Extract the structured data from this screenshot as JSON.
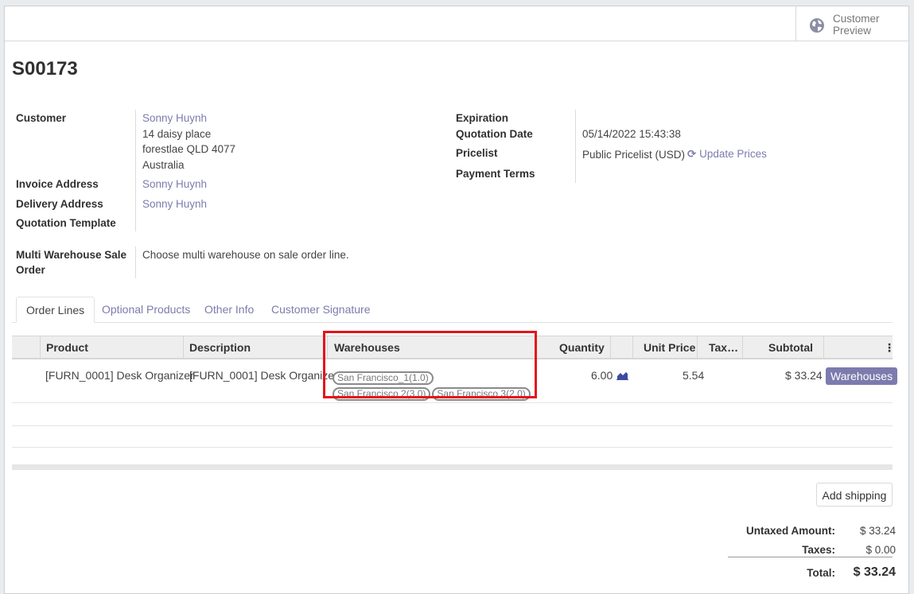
{
  "header": {
    "preview_label": "Customer\nPreview",
    "icon": "globe-icon"
  },
  "order": {
    "name": "S00173"
  },
  "left_fields": {
    "customer_label": "Customer",
    "customer_name": "Sonny Huynh",
    "address_line1": "14 daisy place",
    "address_line2": "forestlae QLD 4077",
    "address_line3": "Australia",
    "invoice_label": "Invoice Address",
    "invoice_value": "Sonny Huynh",
    "delivery_label": "Delivery Address",
    "delivery_value": "Sonny Huynh",
    "template_label": "Quotation Template",
    "multi_label_1": "Multi Warehouse Sale",
    "multi_label_2": "Order",
    "multi_value": "Choose multi warehouse on sale order line."
  },
  "right_fields": {
    "expiration_label": "Expiration",
    "quotation_date_label": "Quotation Date",
    "quotation_date_value": "05/14/2022 15:43:38",
    "pricelist_label": "Pricelist",
    "pricelist_value": "Public Pricelist (USD)",
    "update_prices": "Update Prices",
    "payment_terms_label": "Payment Terms"
  },
  "tabs": [
    "Order Lines",
    "Optional Products",
    "Other Info",
    "Customer Signature"
  ],
  "columns": {
    "product": "Product",
    "description": "Description",
    "warehouses": "Warehouses",
    "quantity": "Quantity",
    "unit_price": "Unit Price",
    "taxes": "Tax…",
    "subtotal": "Subtotal",
    "options": "⋮"
  },
  "line": {
    "product": "[FURN_0001] Desk Organizer",
    "description": "[FURN_0001] Desk Organizer",
    "warehouse_tags": [
      "San Francisco_1(1.0)",
      "San Francisco 2(3.0)",
      "San Francisco 3(2.0)"
    ],
    "quantity": "6.00",
    "unit_price": "5.54",
    "subtotal": "$ 33.24",
    "button": "Warehouses"
  },
  "totals": {
    "add_shipping": "Add shipping",
    "untaxed_label": "Untaxed Amount:",
    "untaxed_value": "$ 33.24",
    "taxes_label": "Taxes:",
    "taxes_value": "$ 0.00",
    "total_label": "Total:",
    "total_value": "$ 33.24"
  },
  "colors": {
    "accent": "#7c7bad",
    "highlight": "#e3151a"
  }
}
